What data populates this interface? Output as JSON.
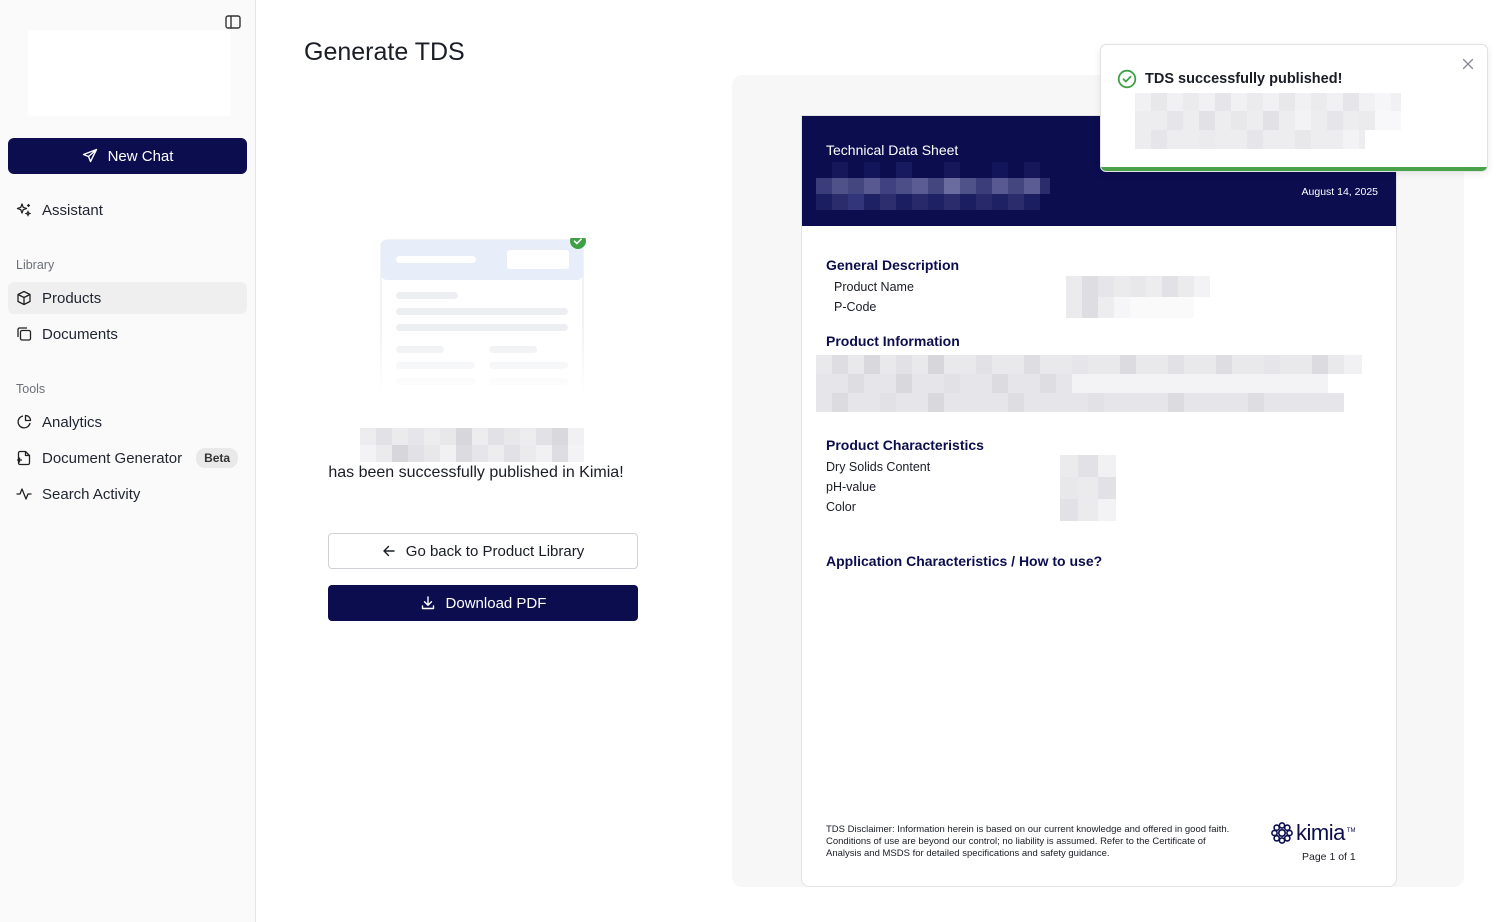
{
  "sidebar": {
    "new_chat_label": "New Chat",
    "assistant_label": "Assistant",
    "library_label": "Library",
    "products_label": "Products",
    "documents_label": "Documents",
    "tools_label": "Tools",
    "analytics_label": "Analytics",
    "document_generator_label": "Document Generator",
    "beta_badge": "Beta",
    "search_activity_label": "Search Activity",
    "active_item": "Products"
  },
  "main": {
    "title": "Generate TDS",
    "success_message": "has been successfully published in Kimia!",
    "back_button_label": "Go back to Product Library",
    "download_button_label": "Download PDF"
  },
  "document": {
    "type": "Technical Data Sheet",
    "date": "August 14, 2025",
    "general_description_heading": "General Description",
    "product_name_label": "Product Name",
    "pcode_label": "P-Code",
    "product_information_heading": "Product Information",
    "product_characteristics_heading": "Product Characteristics",
    "dry_solids_label": "Dry Solids Content",
    "ph_label": "pH-value",
    "color_label": "Color",
    "application_heading": "Application Characteristics / How to use?",
    "disclaimer": "TDS Disclaimer: Information herein is based on our current knowledge and offered in good faith. Conditions of use are beyond our control; no liability is assumed. Refer to the Certificate of Analysis and MSDS for detailed specifications and safety guidance.",
    "logo_text": "kimia",
    "logo_tm": "TM",
    "page_label": "Page 1 of 1"
  },
  "toast": {
    "title": "TDS successfully published!"
  },
  "colors": {
    "brand_navy": "#0c0d4f",
    "success_green": "#49a24a",
    "sidebar_bg": "#fafafa",
    "preview_bg": "#f7f7f7"
  }
}
